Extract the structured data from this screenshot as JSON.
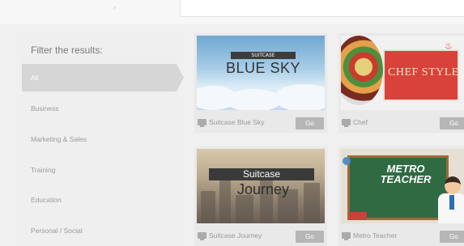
{
  "filter": {
    "title": "Filter the results:",
    "items": [
      {
        "label": "All",
        "active": true
      },
      {
        "label": "Business",
        "active": false
      },
      {
        "label": "Marketing & Sales",
        "active": false
      },
      {
        "label": "Training",
        "active": false
      },
      {
        "label": "Education",
        "active": false
      },
      {
        "label": "Personal / Social",
        "active": false
      }
    ]
  },
  "templates": [
    {
      "name": "Suitcase Blue Sky",
      "thumb_top": "SUITCASE",
      "thumb_title": "BLUE SKY",
      "go": "Go"
    },
    {
      "name": "Chef",
      "thumb_title": "CHEF STYLE",
      "go": "Go"
    },
    {
      "name": "Suitcase Journey",
      "thumb_top": "Suitcase",
      "thumb_title": "Journey",
      "go": "Go"
    },
    {
      "name": "Metro Teacher",
      "thumb_line1": "METRO",
      "thumb_line2": "TEACHER",
      "go": "Go"
    }
  ],
  "colors": {
    "panel_bg": "#efefef",
    "active_item_bg": "#d6d6d6",
    "button_bg": "#b6b6b6"
  }
}
